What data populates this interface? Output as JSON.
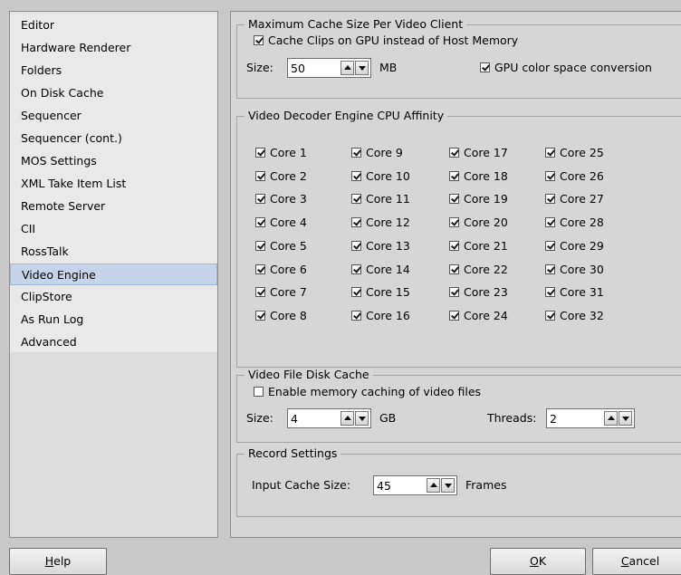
{
  "sidebar": {
    "items": [
      {
        "label": "Editor"
      },
      {
        "label": "Hardware Renderer"
      },
      {
        "label": "Folders"
      },
      {
        "label": "On Disk Cache"
      },
      {
        "label": "Sequencer"
      },
      {
        "label": "Sequencer (cont.)"
      },
      {
        "label": "MOS Settings"
      },
      {
        "label": "XML Take Item List"
      },
      {
        "label": "Remote Server"
      },
      {
        "label": "CII"
      },
      {
        "label": "RossTalk"
      },
      {
        "label": "Video Engine",
        "selected": true
      },
      {
        "label": "ClipStore"
      },
      {
        "label": "As Run Log"
      },
      {
        "label": "Advanced"
      }
    ]
  },
  "cache_group": {
    "title": "Maximum Cache Size Per Video Client",
    "gpu_cache_label": "Cache Clips on GPU instead of Host Memory",
    "gpu_cache_checked": true,
    "size_label": "Size:",
    "size_value": "50",
    "size_unit": "MB",
    "gpu_color_label": "GPU color space conversion",
    "gpu_color_checked": true
  },
  "affinity_group": {
    "title": "Video Decoder Engine CPU Affinity",
    "cores": [
      "Core 1",
      "Core 2",
      "Core 3",
      "Core 4",
      "Core 5",
      "Core 6",
      "Core 7",
      "Core 8",
      "Core 9",
      "Core 10",
      "Core 11",
      "Core 12",
      "Core 13",
      "Core 14",
      "Core 15",
      "Core 16",
      "Core 17",
      "Core 18",
      "Core 19",
      "Core 20",
      "Core 21",
      "Core 22",
      "Core 23",
      "Core 24",
      "Core 25",
      "Core 26",
      "Core 27",
      "Core 28",
      "Core 29",
      "Core 30",
      "Core 31",
      "Core 32"
    ],
    "all_checked": true
  },
  "disk_cache_group": {
    "title": "Video File Disk Cache",
    "enable_label": "Enable memory caching of video files",
    "enable_checked": false,
    "size_label": "Size:",
    "size_value": "4",
    "size_unit": "GB",
    "threads_label": "Threads:",
    "threads_value": "2"
  },
  "record_group": {
    "title": "Record Settings",
    "input_cache_label": "Input Cache Size:",
    "input_cache_value": "45",
    "input_cache_unit": "Frames"
  },
  "buttons": {
    "help_mnemonic": "H",
    "help_rest": "elp",
    "ok_mnemonic": "O",
    "ok_rest": "K",
    "cancel_mnemonic": "C",
    "cancel_rest": "ancel"
  }
}
